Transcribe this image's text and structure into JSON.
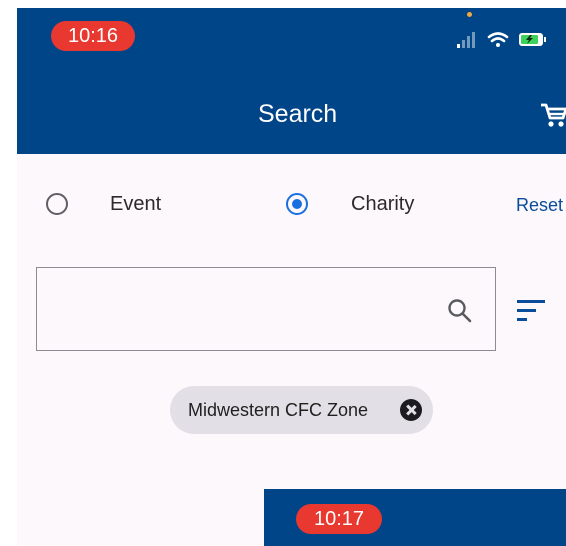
{
  "status_bar": {
    "time": "10:16"
  },
  "header": {
    "title": "Search"
  },
  "search_type": {
    "options": [
      {
        "label": "Event",
        "selected": false
      },
      {
        "label": "Charity",
        "selected": true
      }
    ],
    "reset_label": "Reset"
  },
  "search": {
    "value": "",
    "placeholder": ""
  },
  "filters": {
    "chips": [
      {
        "label": "Midwestern CFC Zone"
      }
    ]
  },
  "overlay_preview": {
    "time": "10:17"
  },
  "colors": {
    "header_bg": "#004588",
    "accent": "#1a6fe0",
    "time_pill": "#e8382f",
    "background": "#fcf8fb"
  },
  "icons": [
    "signal-icon",
    "wifi-icon",
    "battery-icon",
    "cart-icon",
    "search-icon",
    "filter-icon",
    "close-icon"
  ]
}
